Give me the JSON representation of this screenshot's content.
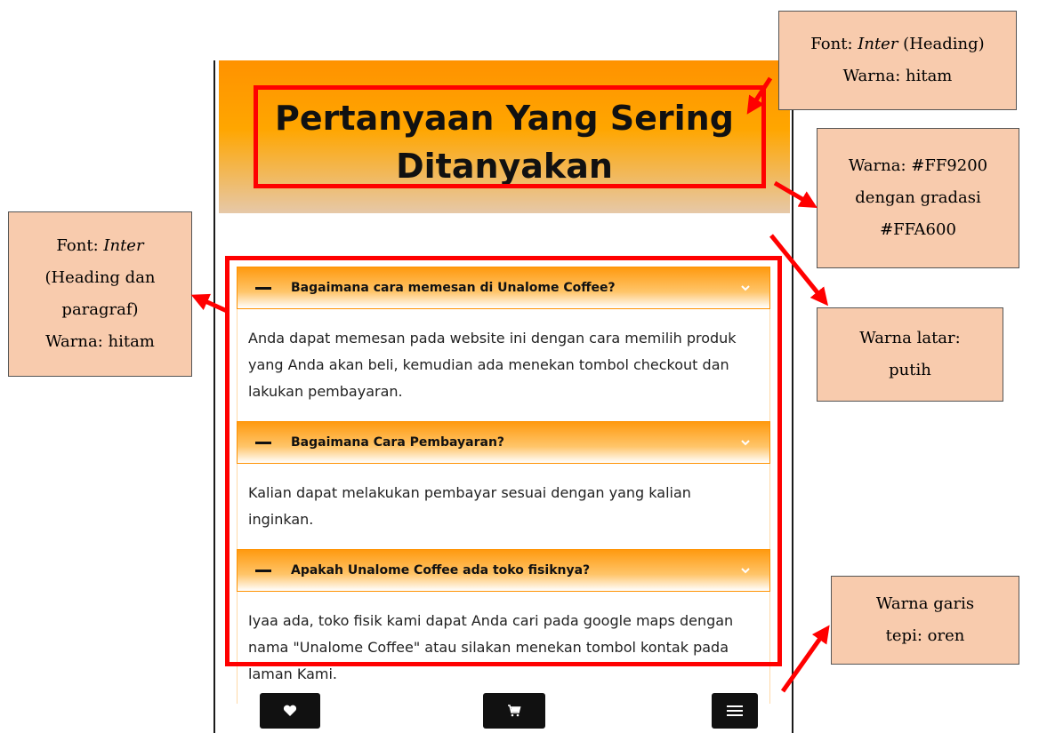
{
  "page": {
    "title": "Pertanyaan Yang Sering Ditanyakan"
  },
  "colors": {
    "header_gradient_start": "#FF9200",
    "header_gradient_end": "#FFA600",
    "background": "#FFFFFF",
    "border": "#FF9200",
    "annotation_fill": "#F8CBAD",
    "highlight": "#FF0000",
    "text": "#000000"
  },
  "faq": [
    {
      "question": "Bagaimana cara memesan di Unalome Coffee?",
      "answer": "Anda dapat memesan pada website ini dengan cara memilih produk yang Anda akan beli, kemudian ada menekan tombol checkout dan lakukan pembayaran."
    },
    {
      "question": "Bagaimana Cara Pembayaran?",
      "answer": "Kalian dapat melakukan pembayar sesuai dengan yang kalian inginkan."
    },
    {
      "question": "Apakah Unalome Coffee ada toko fisiknya?",
      "answer": "Iyaa ada, toko fisik kami dapat Anda cari pada google maps dengan nama \"Unalome Coffee\" atau silakan menekan tombol kontak pada laman Kami."
    }
  ],
  "bottom_nav": [
    {
      "icon": "heart-icon"
    },
    {
      "icon": "cart-icon"
    },
    {
      "icon": "menu-icon"
    }
  ],
  "annotations": {
    "heading_font": {
      "line1_prefix": "Font: ",
      "line1_font": "Inter",
      "line1_suffix": " (Heading)",
      "line2": "Warna: hitam"
    },
    "header_color": {
      "line1": "Warna: #FF9200",
      "line2": "dengan gradasi",
      "line3": "#FFA600"
    },
    "faq_font": {
      "line1_prefix": "Font: ",
      "line1_font": "Inter",
      "line2": "(Heading dan",
      "line3": "paragraf)",
      "line4": "Warna: hitam"
    },
    "background": {
      "line1": "Warna latar:",
      "line2": "putih"
    },
    "border": {
      "line1": "Warna garis",
      "line2": "tepi: oren"
    }
  }
}
